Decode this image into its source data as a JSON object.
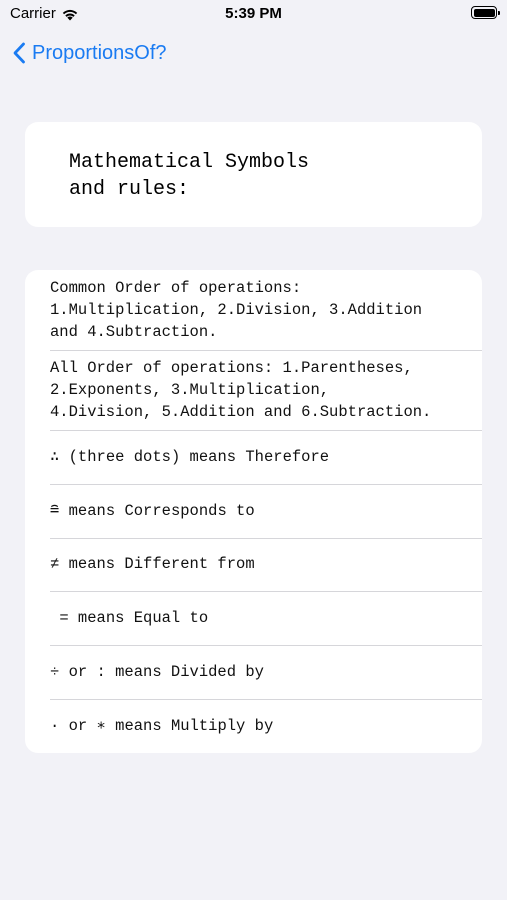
{
  "status_bar": {
    "carrier": "Carrier",
    "time": "5:39 PM"
  },
  "nav": {
    "back_label": "ProportionsOf?",
    "accent_color": "#1a7bf2"
  },
  "header": {
    "title": "Mathematical Symbols\nand rules:"
  },
  "items": [
    "Common Order of operations:\n1.Multiplication, 2.Division, 3.Addition\nand 4.Subtraction.",
    "All Order of operations: 1.Parentheses,\n2.Exponents, 3.Multiplication,\n4.Division, 5.Addition and 6.Subtraction.",
    "∴ (three dots) means Therefore",
    "≘ means Corresponds to",
    "≠ means Different from",
    " = means Equal to",
    "÷ or : means Divided by",
    "· or ∗ means Multiply by"
  ]
}
